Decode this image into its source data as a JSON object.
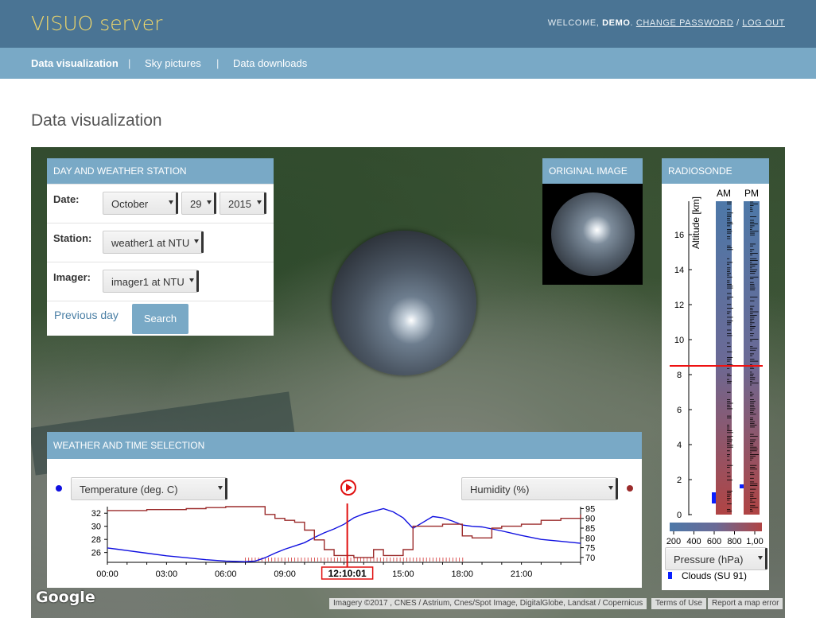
{
  "header": {
    "brand": "VISUO server",
    "welcome_prefix": "WELCOME, ",
    "username": "DEMO",
    "change_password": "CHANGE PASSWORD",
    "separator": " / ",
    "logout": "LOG OUT"
  },
  "nav": {
    "items": [
      {
        "label": "Data visualization",
        "active": true
      },
      {
        "label": "Sky pictures",
        "active": false
      },
      {
        "label": "Data downloads",
        "active": false
      }
    ],
    "separator": "|"
  },
  "page": {
    "title": "Data visualization"
  },
  "station_panel": {
    "title": "DAY AND WEATHER STATION",
    "date_label": "Date:",
    "month": "October",
    "day": "29",
    "year": "2015",
    "station_label": "Station:",
    "station": "weather1 at NTU",
    "imager_label": "Imager:",
    "imager": "imager1 at NTU",
    "previous_day": "Previous day",
    "search": "Search"
  },
  "original_image": {
    "title": "ORIGINAL IMAGE"
  },
  "radiosonde": {
    "title": "RADIOSONDE",
    "am_label": "AM",
    "pm_label": "PM",
    "ylabel": "Altitude [km]",
    "y_ticks": [
      "0",
      "2",
      "4",
      "6",
      "8",
      "10",
      "12",
      "14",
      "16"
    ],
    "pressure_ticks": [
      "200",
      "400",
      "600",
      "800",
      "1,00"
    ],
    "pressure_select": "Pressure (hPa)",
    "clouds_legend": "Clouds (SU 91)",
    "marker_altitude_km": 8.5
  },
  "weather_panel": {
    "title": "WEATHER AND TIME SELECTION",
    "left_select": "Temperature (deg. C)",
    "right_select": "Humidity (%)",
    "current_time": "12:10:01"
  },
  "colors": {
    "header": "#4a7494",
    "nav": "#79a9c6",
    "brand": "#f1d86a",
    "temperature": "#1010e0",
    "humidity": "#9b2b2b",
    "marker": "#e01010"
  },
  "chart_data": {
    "type": "line",
    "x_ticks": [
      "00:00",
      "03:00",
      "06:00",
      "09:00",
      "12:10:01",
      "15:00",
      "18:00",
      "21:00"
    ],
    "x_tick_hours": [
      0,
      3,
      6,
      9,
      12.167,
      15,
      18,
      21
    ],
    "xlim": [
      0,
      24
    ],
    "y_left_ticks": [
      "32",
      "30",
      "28",
      "26"
    ],
    "y_left_ticks_values": [
      32,
      30,
      28,
      26
    ],
    "ylim_left": [
      24.5,
      33
    ],
    "y_right_ticks": [
      "95",
      "90",
      "85",
      "80",
      "75",
      "70"
    ],
    "y_right_ticks_values": [
      95,
      90,
      85,
      80,
      75,
      70
    ],
    "ylim_right": [
      67.5,
      96
    ],
    "series": [
      {
        "name": "Temperature (deg. C)",
        "axis": "left",
        "x": [
          0,
          0.5,
          1,
          2,
          3,
          4,
          5,
          6,
          7,
          7.5,
          8,
          8.5,
          9,
          9.5,
          10,
          10.5,
          11,
          11.5,
          12,
          12.5,
          13,
          13.5,
          14,
          14.5,
          15,
          15.5,
          16,
          16.5,
          17,
          17.5,
          18,
          18.5,
          19,
          19.5,
          20,
          21,
          22,
          23,
          24
        ],
        "y": [
          26.7,
          26.5,
          26.3,
          25.9,
          25.5,
          25.2,
          24.9,
          24.7,
          24.6,
          24.7,
          25.2,
          25.9,
          26.5,
          27.0,
          27.5,
          28.3,
          29.0,
          29.6,
          30.3,
          31.3,
          31.9,
          32.3,
          32.7,
          32.2,
          31.3,
          29.7,
          30.6,
          31.5,
          31.3,
          30.8,
          30.2,
          30.0,
          29.9,
          29.6,
          29.3,
          28.6,
          28.0,
          27.7,
          27.4
        ]
      },
      {
        "name": "Humidity (%)",
        "axis": "right",
        "x": [
          0,
          1,
          2,
          3,
          4,
          5,
          6,
          7,
          8,
          8.5,
          9,
          9.5,
          10,
          10.5,
          11,
          11.5,
          12,
          12.5,
          13,
          13.5,
          14,
          14.5,
          15,
          15.5,
          16,
          16.5,
          17,
          17.5,
          18,
          18.5,
          19,
          19.5,
          20,
          21,
          22,
          23,
          24
        ],
        "y": [
          94,
          94,
          94.5,
          94.5,
          95,
          95.5,
          96,
          96,
          92,
          90,
          89,
          88,
          84,
          79,
          74,
          71,
          71,
          70,
          70,
          74,
          71,
          71,
          74,
          86,
          86,
          86,
          87,
          87,
          81,
          80,
          80,
          85,
          86,
          87,
          89,
          90,
          92
        ]
      }
    ],
    "current_time_hours": 12.167
  },
  "map": {
    "logo": "Google",
    "imagery": "Imagery ©2017 , CNES / Astrium, Cnes/Spot Image, DigitalGlobe, Landsat / Copernicus",
    "terms": "Terms of Use",
    "report": "Report a map error"
  }
}
